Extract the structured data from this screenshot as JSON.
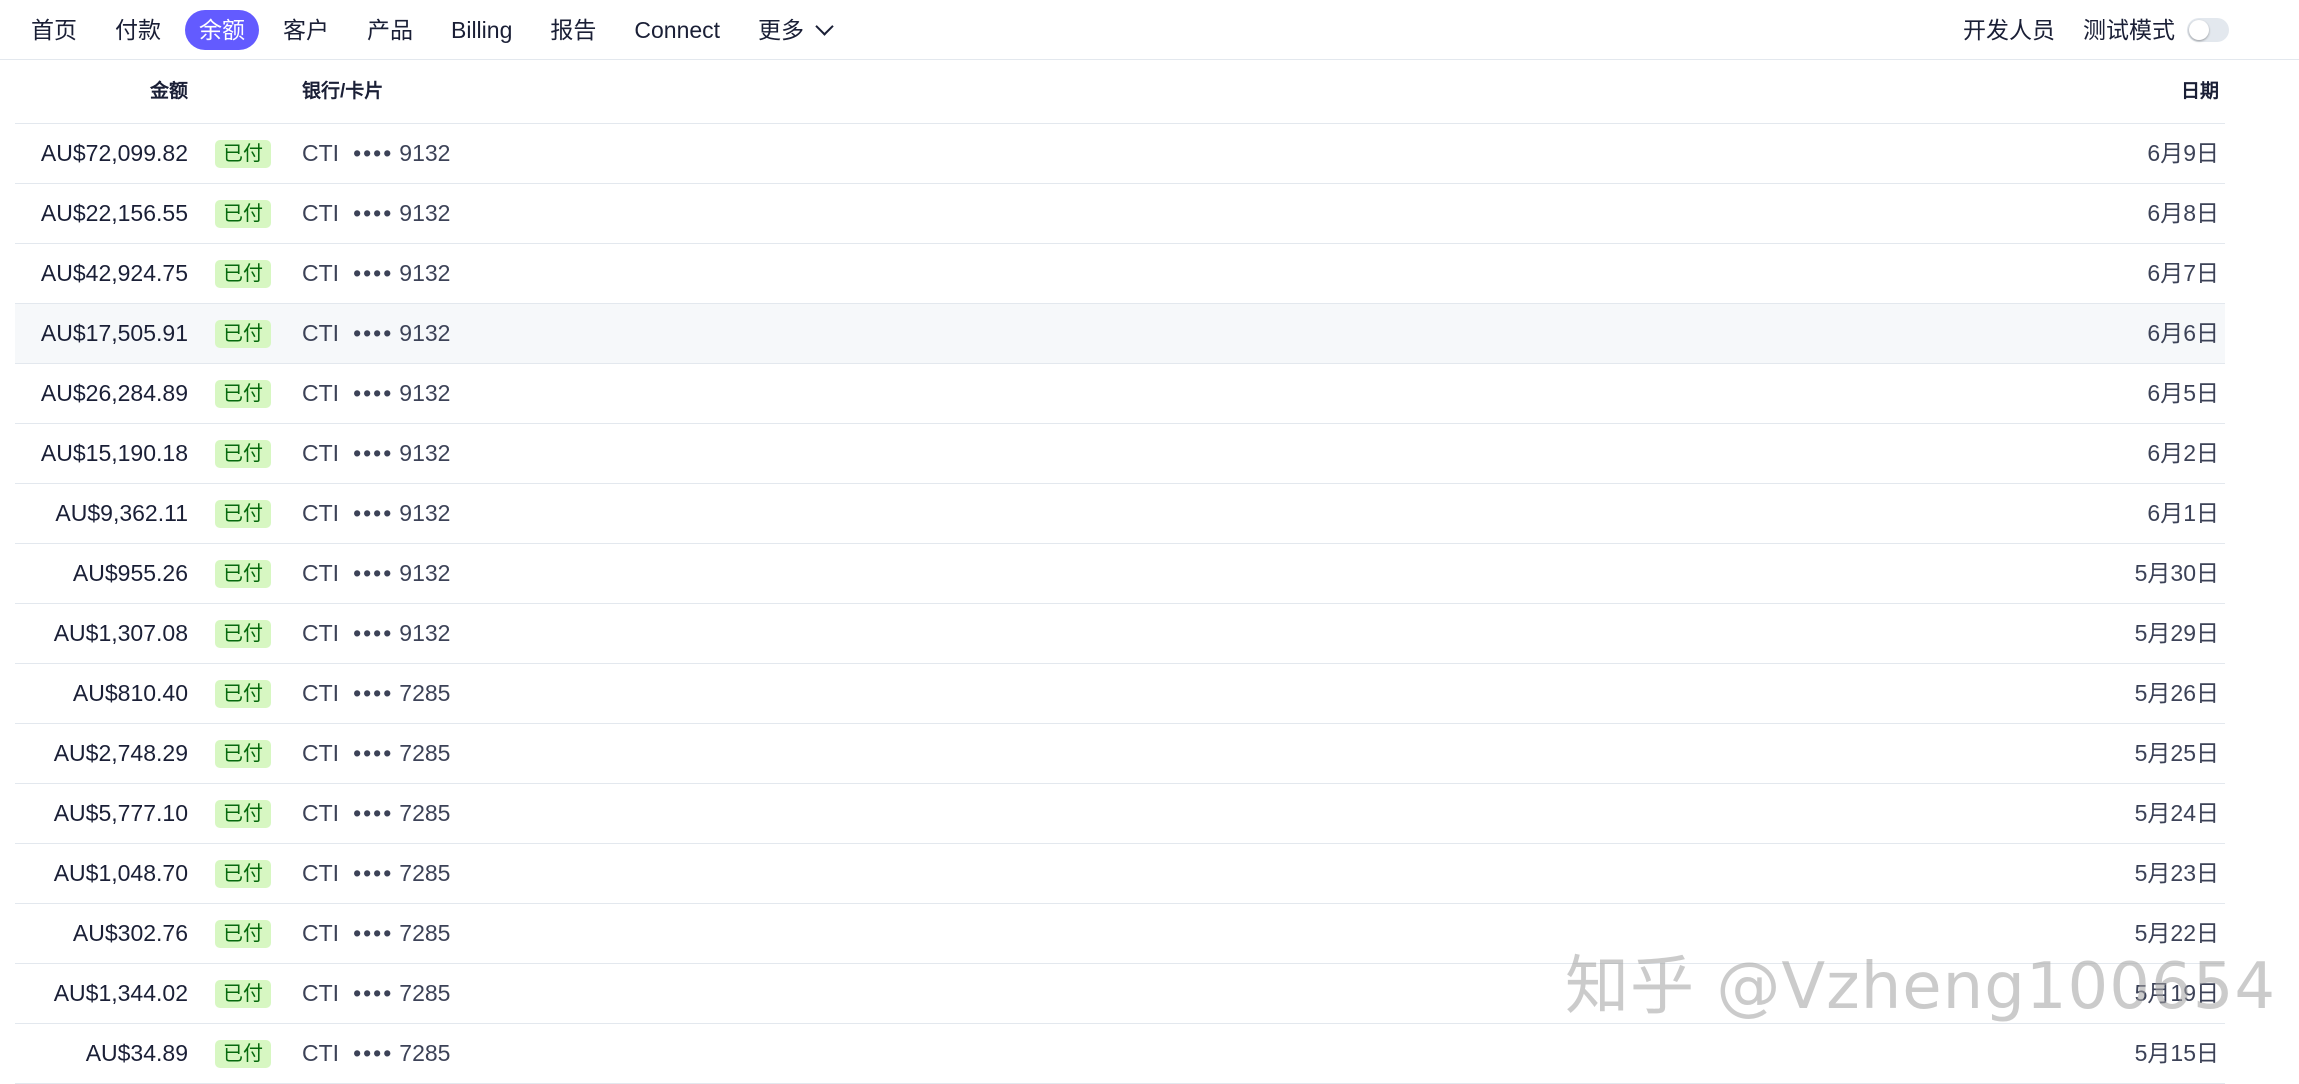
{
  "nav": {
    "items": [
      {
        "label": "首页",
        "active": false
      },
      {
        "label": "付款",
        "active": false
      },
      {
        "label": "余额",
        "active": true
      },
      {
        "label": "客户",
        "active": false
      },
      {
        "label": "产品",
        "active": false
      },
      {
        "label": "Billing",
        "active": false
      },
      {
        "label": "报告",
        "active": false
      },
      {
        "label": "Connect",
        "active": false
      }
    ],
    "more_label": "更多",
    "developers_label": "开发人员",
    "test_mode_label": "测试模式",
    "test_mode_on": false,
    "accent_color": "#635bff"
  },
  "table": {
    "headers": {
      "amount": "金额",
      "bank": "银行/卡片",
      "date": "日期"
    },
    "status_color_bg": "#d7f7c2",
    "status_color_text": "#05690d",
    "rows": [
      {
        "amount": "AU$72,099.82",
        "status": "已付",
        "bank": "CTI",
        "dots": "••••",
        "last4": "9132",
        "date": "6月9日"
      },
      {
        "amount": "AU$22,156.55",
        "status": "已付",
        "bank": "CTI",
        "dots": "••••",
        "last4": "9132",
        "date": "6月8日"
      },
      {
        "amount": "AU$42,924.75",
        "status": "已付",
        "bank": "CTI",
        "dots": "••••",
        "last4": "9132",
        "date": "6月7日"
      },
      {
        "amount": "AU$17,505.91",
        "status": "已付",
        "bank": "CTI",
        "dots": "••••",
        "last4": "9132",
        "date": "6月6日"
      },
      {
        "amount": "AU$26,284.89",
        "status": "已付",
        "bank": "CTI",
        "dots": "••••",
        "last4": "9132",
        "date": "6月5日"
      },
      {
        "amount": "AU$15,190.18",
        "status": "已付",
        "bank": "CTI",
        "dots": "••••",
        "last4": "9132",
        "date": "6月2日"
      },
      {
        "amount": "AU$9,362.11",
        "status": "已付",
        "bank": "CTI",
        "dots": "••••",
        "last4": "9132",
        "date": "6月1日"
      },
      {
        "amount": "AU$955.26",
        "status": "已付",
        "bank": "CTI",
        "dots": "••••",
        "last4": "9132",
        "date": "5月30日"
      },
      {
        "amount": "AU$1,307.08",
        "status": "已付",
        "bank": "CTI",
        "dots": "••••",
        "last4": "9132",
        "date": "5月29日"
      },
      {
        "amount": "AU$810.40",
        "status": "已付",
        "bank": "CTI",
        "dots": "••••",
        "last4": "7285",
        "date": "5月26日"
      },
      {
        "amount": "AU$2,748.29",
        "status": "已付",
        "bank": "CTI",
        "dots": "••••",
        "last4": "7285",
        "date": "5月25日"
      },
      {
        "amount": "AU$5,777.10",
        "status": "已付",
        "bank": "CTI",
        "dots": "••••",
        "last4": "7285",
        "date": "5月24日"
      },
      {
        "amount": "AU$1,048.70",
        "status": "已付",
        "bank": "CTI",
        "dots": "••••",
        "last4": "7285",
        "date": "5月23日"
      },
      {
        "amount": "AU$302.76",
        "status": "已付",
        "bank": "CTI",
        "dots": "••••",
        "last4": "7285",
        "date": "5月22日"
      },
      {
        "amount": "AU$1,344.02",
        "status": "已付",
        "bank": "CTI",
        "dots": "••••",
        "last4": "7285",
        "date": "5月19日"
      },
      {
        "amount": "AU$34.89",
        "status": "已付",
        "bank": "CTI",
        "dots": "••••",
        "last4": "7285",
        "date": "5月15日"
      }
    ]
  },
  "watermark": "知乎 @Vzheng100654"
}
